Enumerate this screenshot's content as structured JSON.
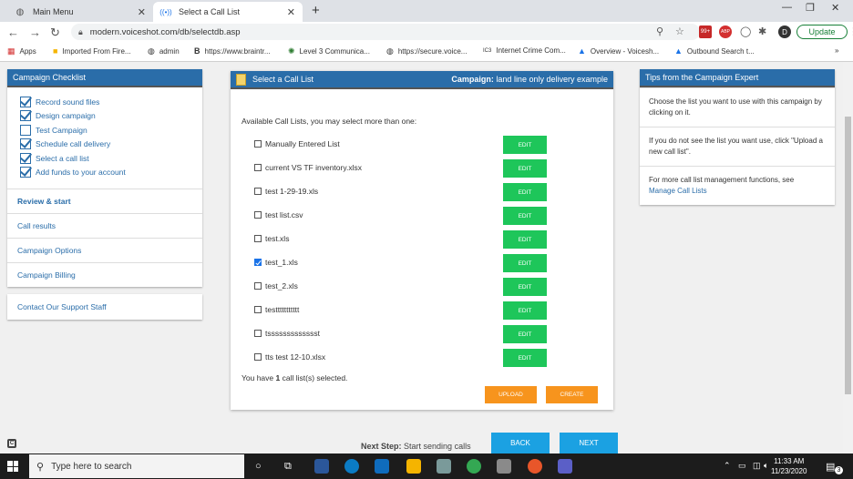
{
  "browser": {
    "tabs": [
      {
        "label": "Main Menu",
        "active": false
      },
      {
        "label": "Select a Call List",
        "active": true
      }
    ],
    "url": "modern.voiceshot.com/db/selectdb.asp",
    "update_label": "Update",
    "profile_initial": "D",
    "bookmarks": [
      "Apps",
      "Imported From Fire...",
      "admin",
      "https://www.braintr...",
      "Level 3 Communica...",
      "https://secure.voice...",
      "Internet Crime Com...",
      "Overview - Voicesh...",
      "Outbound Search t..."
    ]
  },
  "left": {
    "checklist_title": "Campaign Checklist",
    "checklist": [
      {
        "label": "Record sound files",
        "checked": true
      },
      {
        "label": "Design campaign",
        "checked": true
      },
      {
        "label": "Test Campaign",
        "checked": false
      },
      {
        "label": "Schedule call delivery",
        "checked": true
      },
      {
        "label": "Select a call list",
        "checked": true
      },
      {
        "label": "Add funds to your account",
        "checked": true
      }
    ],
    "nav": [
      "Review & start",
      "Call results",
      "Campaign Options",
      "Campaign Billing"
    ],
    "support": "Contact Our Support Staff"
  },
  "center": {
    "title": "Select a Call List",
    "campaign_label": "Campaign:",
    "campaign_value": "land line only delivery example",
    "instructions": "Available Call Lists, you may select more than one:",
    "edit_label": "EDIT",
    "lists": [
      {
        "name": "Manually Entered List",
        "checked": false
      },
      {
        "name": "current VS TF inventory.xlsx",
        "checked": false
      },
      {
        "name": "test 1-29-19.xls",
        "checked": false
      },
      {
        "name": "test list.csv",
        "checked": false
      },
      {
        "name": "test.xls",
        "checked": false
      },
      {
        "name": "test_1.xls",
        "checked": true
      },
      {
        "name": "test_2.xls",
        "checked": false
      },
      {
        "name": "testtttttttttt",
        "checked": false
      },
      {
        "name": "tssssssssssssst",
        "checked": false
      },
      {
        "name": "tts test 12-10.xlsx",
        "checked": false
      }
    ],
    "sel_prefix": "You have",
    "sel_count": "1",
    "sel_suffix": "call list(s) selected.",
    "upload_label": "UPLOAD",
    "create_label": "CREATE"
  },
  "right": {
    "title": "Tips from the Campaign Expert",
    "tip1": "Choose the list you want to use with this campaign by clicking on it.",
    "tip2": "If you do not see the list you want use, click \"Upload a new call list\".",
    "tip3": "For more call list management functions, see",
    "tip3_link": "Manage Call Lists"
  },
  "footer": {
    "next_label": "Next Step:",
    "next_value": "Start sending calls",
    "back_label": "BACK",
    "next_button": "NEXT"
  },
  "taskbar": {
    "search_placeholder": "Type here to search",
    "time": "11:33 AM",
    "date": "11/23/2020",
    "notif_count": "3"
  }
}
